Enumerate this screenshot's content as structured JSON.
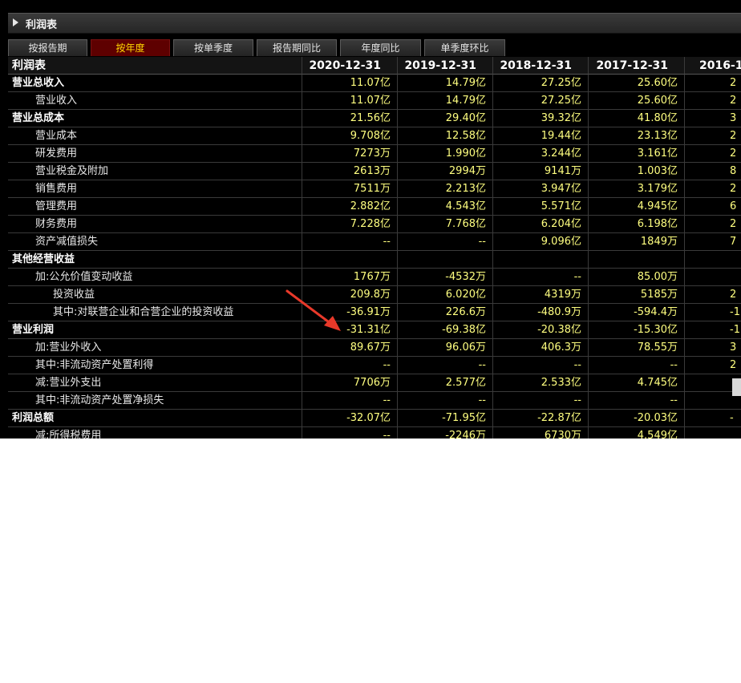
{
  "panel": {
    "title": "利润表"
  },
  "tabs": [
    "按报告期",
    "按年度",
    "按单季度",
    "报告期同比",
    "年度同比",
    "单季度环比"
  ],
  "active_tab": 1,
  "table": {
    "header_label": "利润表",
    "columns": [
      "2020-12-31",
      "2019-12-31",
      "2018-12-31",
      "2017-12-31",
      "2016-1"
    ],
    "rows": [
      {
        "label": "营业总收入",
        "level": 0,
        "bold": true,
        "values": [
          "11.07亿",
          "14.79亿",
          "27.25亿",
          "25.60亿",
          "2"
        ]
      },
      {
        "label": "营业收入",
        "level": 1,
        "bold": false,
        "values": [
          "11.07亿",
          "14.79亿",
          "27.25亿",
          "25.60亿",
          "2"
        ]
      },
      {
        "label": "营业总成本",
        "level": 0,
        "bold": true,
        "values": [
          "21.56亿",
          "29.40亿",
          "39.32亿",
          "41.80亿",
          "3"
        ]
      },
      {
        "label": "营业成本",
        "level": 1,
        "bold": false,
        "values": [
          "9.708亿",
          "12.58亿",
          "19.44亿",
          "23.13亿",
          "2"
        ]
      },
      {
        "label": "研发费用",
        "level": 1,
        "bold": false,
        "values": [
          "7273万",
          "1.990亿",
          "3.244亿",
          "3.161亿",
          "2"
        ]
      },
      {
        "label": "营业税金及附加",
        "level": 1,
        "bold": false,
        "values": [
          "2613万",
          "2994万",
          "9141万",
          "1.003亿",
          "8"
        ]
      },
      {
        "label": "销售费用",
        "level": 1,
        "bold": false,
        "values": [
          "7511万",
          "2.213亿",
          "3.947亿",
          "3.179亿",
          "2"
        ]
      },
      {
        "label": "管理费用",
        "level": 1,
        "bold": false,
        "values": [
          "2.882亿",
          "4.543亿",
          "5.571亿",
          "4.945亿",
          "6"
        ]
      },
      {
        "label": "财务费用",
        "level": 1,
        "bold": false,
        "values": [
          "7.228亿",
          "7.768亿",
          "6.204亿",
          "6.198亿",
          "2"
        ]
      },
      {
        "label": "资产减值损失",
        "level": 1,
        "bold": false,
        "values": [
          "--",
          "--",
          "9.096亿",
          "1849万",
          "7"
        ]
      },
      {
        "label": "其他经营收益",
        "level": 0,
        "bold": true,
        "values": [
          "",
          "",
          "",
          "",
          ""
        ]
      },
      {
        "label": "加:公允价值变动收益",
        "level": 1,
        "bold": false,
        "values": [
          "1767万",
          "-4532万",
          "--",
          "85.00万",
          ""
        ]
      },
      {
        "label": "投资收益",
        "level": 2,
        "bold": false,
        "values": [
          "209.8万",
          "6.020亿",
          "4319万",
          "5185万",
          "2"
        ]
      },
      {
        "label": "其中:对联营企业和合营企业的投资收益",
        "level": 2,
        "bold": false,
        "values": [
          "-36.91万",
          "226.6万",
          "-480.9万",
          "-594.4万",
          "-1"
        ]
      },
      {
        "label": "营业利润",
        "level": 0,
        "bold": true,
        "values": [
          "-31.31亿",
          "-69.38亿",
          "-20.38亿",
          "-15.30亿",
          "-1"
        ]
      },
      {
        "label": "加:营业外收入",
        "level": 1,
        "bold": false,
        "values": [
          "89.67万",
          "96.06万",
          "406.3万",
          "78.55万",
          "3"
        ]
      },
      {
        "label": "其中:非流动资产处置利得",
        "level": 1,
        "bold": false,
        "values": [
          "--",
          "--",
          "--",
          "--",
          "2"
        ]
      },
      {
        "label": "减:营业外支出",
        "level": 1,
        "bold": false,
        "values": [
          "7706万",
          "2.577亿",
          "2.533亿",
          "4.745亿",
          ""
        ]
      },
      {
        "label": "其中:非流动资产处置净损失",
        "level": 1,
        "bold": false,
        "values": [
          "--",
          "--",
          "--",
          "--",
          ""
        ]
      },
      {
        "label": "利润总额",
        "level": 0,
        "bold": true,
        "values": [
          "-32.07亿",
          "-71.95亿",
          "-22.87亿",
          "-20.03亿",
          "-"
        ]
      },
      {
        "label": "减:所得税费用",
        "level": 1,
        "bold": false,
        "values": [
          "--",
          "-2246万",
          "6730万",
          "4.549亿",
          ""
        ]
      }
    ]
  },
  "colors": {
    "background": "#000000",
    "value_text": "#ffff80",
    "active_tab_bg": "#5e0000",
    "active_tab_text": "#ffd700",
    "arrow": "#e8392a"
  }
}
